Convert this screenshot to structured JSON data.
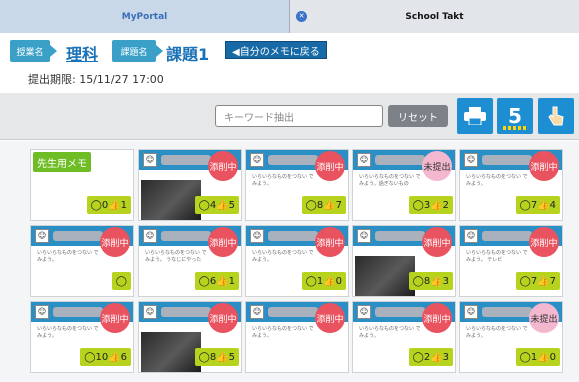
{
  "tabs": [
    {
      "label": "MyPortal"
    },
    {
      "label": "School Takt"
    }
  ],
  "header": {
    "crumb_subject_label": "授業名",
    "subject": "理科",
    "crumb_task_label": "課題名",
    "task": "課題1",
    "back_button": "◀自分のメモに戻る",
    "deadline": "提出期限: 15/11/27 17:00"
  },
  "toolbar": {
    "search_placeholder": "キーワード抽出",
    "reset_label": "リセット",
    "columns_value": "5"
  },
  "teacher_memo": {
    "label": "先生用メモ",
    "counter": "◯0👍1"
  },
  "status_colors": {
    "editing": "#e9525f",
    "not_submitted": "#f3b7cf",
    "header": "#2a8fc4",
    "counter": "#b7d31e"
  },
  "cards": [
    {
      "status": "添削中",
      "counter": "◯4👍5",
      "small": "いらいらなものをつない でみよう。",
      "photo": true
    },
    {
      "status": "添削中",
      "counter": "◯8👍7",
      "small": "いらいらなものをつない でみよう。",
      "photo": false
    },
    {
      "status": "未提出",
      "counter": "◯3👍2",
      "small": "いらいらなものをつない でみよう。過ぎないもの",
      "photo": false
    },
    {
      "status": "添削中",
      "counter": "◯7👍4",
      "small": "いらいらなものをつない でみよう。",
      "photo": false
    },
    {
      "status": "添削中",
      "counter": "◯",
      "small": "いらいらなものをつない でみよう。",
      "photo": false
    },
    {
      "status": "添削中",
      "counter": "◯6👍1",
      "small": "いらいらなものをつない でみよう。 うなじにやった",
      "photo": false
    },
    {
      "status": "添削中",
      "counter": "◯1👍0",
      "small": "いらいらなものをつない でみよう。",
      "photo": false
    },
    {
      "status": "添削中",
      "counter": "◯8👍3",
      "small": "いらいらなものをつない でみよう。",
      "photo": true
    },
    {
      "status": "添削中",
      "counter": "◯7👍7",
      "small": "いらいらなものをつない でみよう。 テレビ",
      "photo": false
    },
    {
      "status": "添削中",
      "counter": "◯10👍6",
      "small": "いらいらなものをつない でみよう。",
      "photo": false
    },
    {
      "status": "添削中",
      "counter": "◯8👍5",
      "small": "いらいらなものをつない でみよう。",
      "photo": true
    },
    {
      "status": "添削中",
      "counter": "",
      "small": "いらいらなものをつない でみよう。",
      "photo": false
    },
    {
      "status": "添削中",
      "counter": "◯2👍3",
      "small": "いらいらなものをつない でみよう。",
      "photo": false
    },
    {
      "status": "未提出",
      "counter": "◯1👍0",
      "small": "いらいらなものをつない でみよう。",
      "photo": false
    }
  ]
}
